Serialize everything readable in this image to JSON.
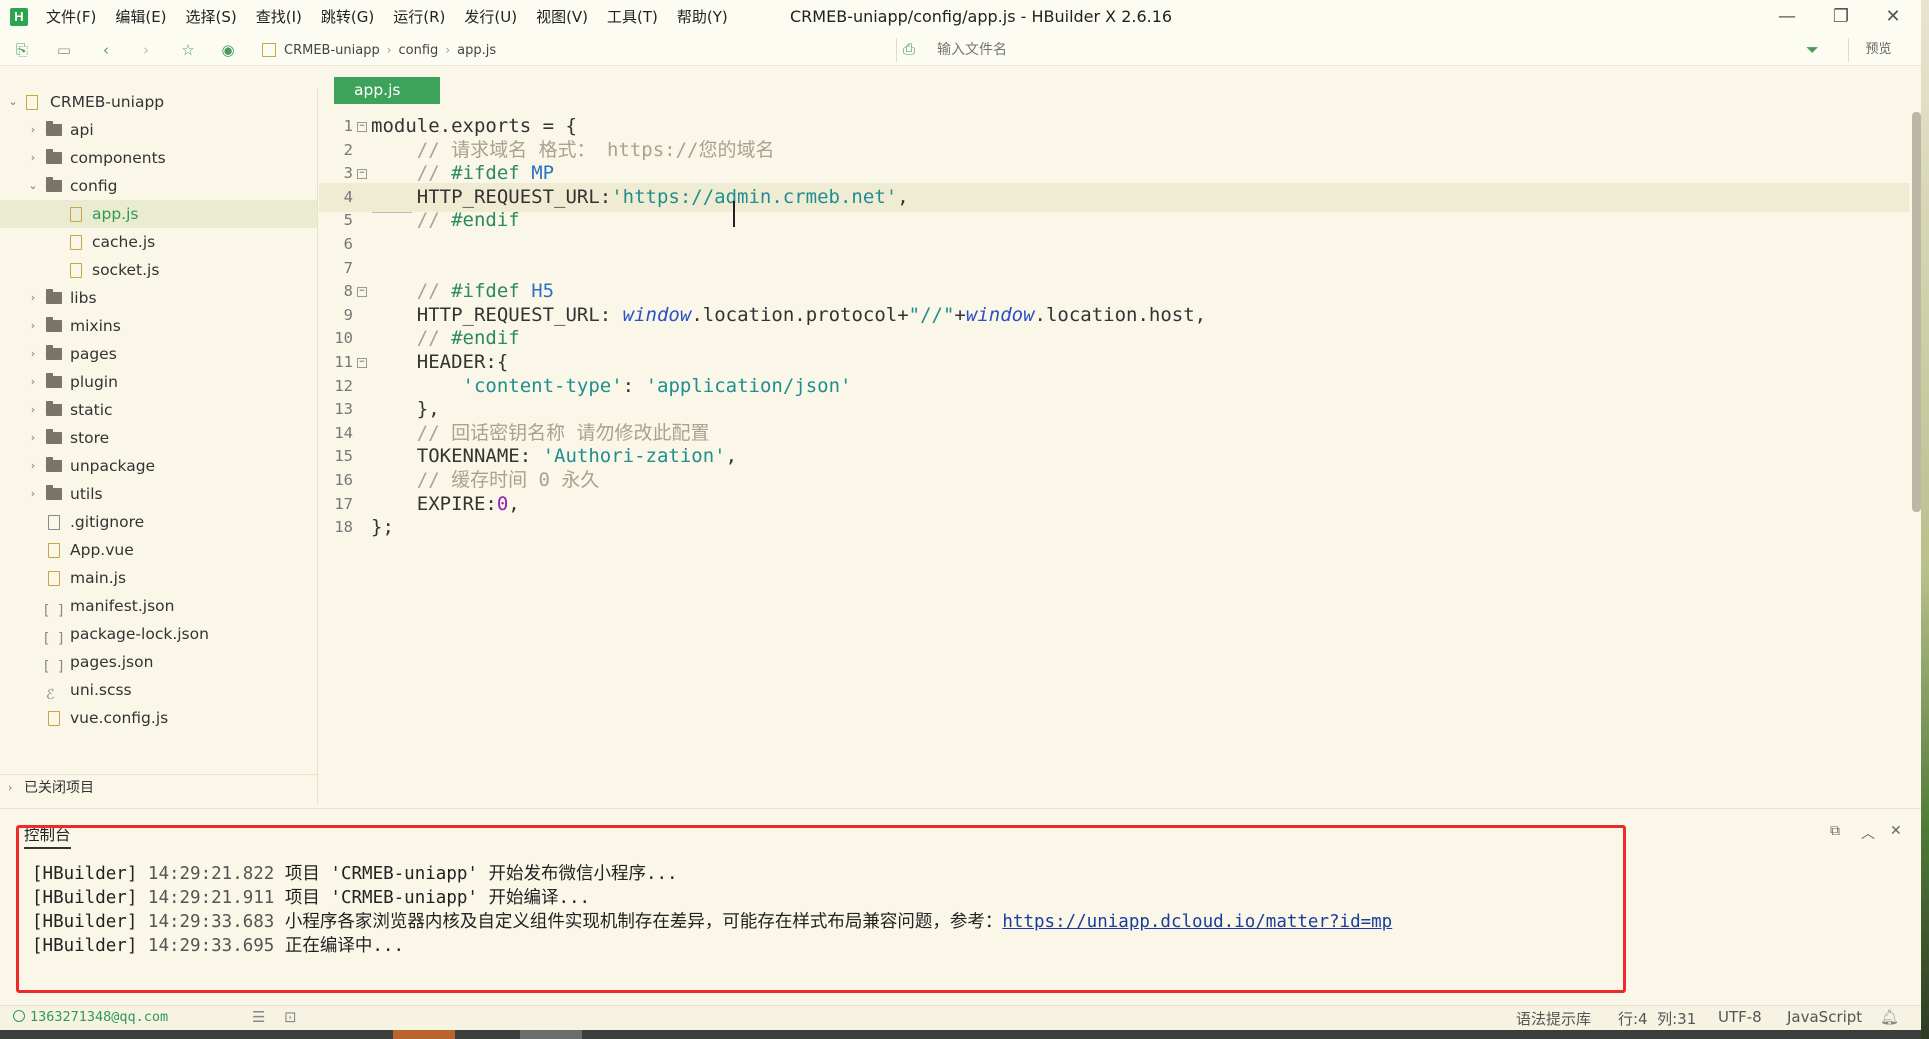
{
  "app": {
    "logo": "H",
    "title": "CRMEB-uniapp/config/app.js - HBuilder X 2.6.16"
  },
  "menu": [
    "文件(F)",
    "编辑(E)",
    "选择(S)",
    "查找(I)",
    "跳转(G)",
    "运行(R)",
    "发行(U)",
    "视图(V)",
    "工具(T)",
    "帮助(Y)"
  ],
  "window_controls": {
    "minimize": "—",
    "maximize": "❐",
    "close": "✕"
  },
  "toolbar": {
    "breadcrumb": [
      "CRMEB-uniapp",
      "config",
      "app.js"
    ],
    "file_search_placeholder": "输入文件名",
    "preview_label": "预览",
    "icons": [
      "new-file-icon",
      "save-icon",
      "back-icon",
      "forward-icon",
      "favorite-icon",
      "run-icon"
    ]
  },
  "sidebar": {
    "project": "CRMEB-uniapp",
    "items": [
      {
        "label": "api",
        "type": "folder",
        "level": 1,
        "expanded": false
      },
      {
        "label": "components",
        "type": "folder",
        "level": 1,
        "expanded": false
      },
      {
        "label": "config",
        "type": "folder",
        "level": 1,
        "expanded": true
      },
      {
        "label": "app.js",
        "type": "js",
        "level": 2,
        "selected": true
      },
      {
        "label": "cache.js",
        "type": "js",
        "level": 2
      },
      {
        "label": "socket.js",
        "type": "js",
        "level": 2
      },
      {
        "label": "libs",
        "type": "folder",
        "level": 1,
        "expanded": false
      },
      {
        "label": "mixins",
        "type": "folder",
        "level": 1,
        "expanded": false
      },
      {
        "label": "pages",
        "type": "folder",
        "level": 1,
        "expanded": false
      },
      {
        "label": "plugin",
        "type": "folder",
        "level": 1,
        "expanded": false
      },
      {
        "label": "static",
        "type": "folder",
        "level": 1,
        "expanded": false
      },
      {
        "label": "store",
        "type": "folder",
        "level": 1,
        "expanded": false
      },
      {
        "label": "unpackage",
        "type": "folder",
        "level": 1,
        "expanded": false
      },
      {
        "label": "utils",
        "type": "folder",
        "level": 1,
        "expanded": false
      },
      {
        "label": ".gitignore",
        "type": "file",
        "level": 1
      },
      {
        "label": "App.vue",
        "type": "vue",
        "level": 1
      },
      {
        "label": "main.js",
        "type": "js",
        "level": 1
      },
      {
        "label": "manifest.json",
        "type": "json",
        "level": 1
      },
      {
        "label": "package-lock.json",
        "type": "json",
        "level": 1
      },
      {
        "label": "pages.json",
        "type": "json",
        "level": 1
      },
      {
        "label": "uni.scss",
        "type": "scss",
        "level": 1
      },
      {
        "label": "vue.config.js",
        "type": "js",
        "level": 1
      }
    ],
    "closed_projects": "已关闭项目"
  },
  "editor": {
    "tab": "app.js",
    "current_line": 4,
    "lines": [
      "module.exports = {",
      "    // 请求域名 格式： https://您的域名",
      "    // #ifdef MP",
      "    HTTP_REQUEST_URL:'https://admin.crmeb.net',",
      "    // #endif",
      "",
      "",
      "    // #ifdef H5",
      "    HTTP_REQUEST_URL: window.location.protocol+\"//\"+window.location.host,",
      "    // #endif",
      "    HEADER:{",
      "        'content-type': 'application/json'",
      "    },",
      "    // 回话密钥名称 请勿修改此配置",
      "    TOKENNAME: 'Authori-zation',",
      "    // 缓存时间 0 永久",
      "    EXPIRE:0,",
      "};"
    ]
  },
  "console": {
    "title": "控制台",
    "lines": [
      {
        "tag": "[HBuilder]",
        "time": "14:29:21.822",
        "msg": "项目 'CRMEB-uniapp' 开始发布微信小程序..."
      },
      {
        "tag": "[HBuilder]",
        "time": "14:29:21.911",
        "msg": "项目 'CRMEB-uniapp' 开始编译..."
      },
      {
        "tag": "[HBuilder]",
        "time": "14:29:33.683",
        "msg": "小程序各家浏览器内核及自定义组件实现机制存在差异，可能存在样式布局兼容问题，参考：",
        "link": "https://uniapp.dcloud.io/matter?id=mp"
      },
      {
        "tag": "[HBuilder]",
        "time": "14:29:33.695",
        "msg": "正在编译中..."
      }
    ]
  },
  "status": {
    "account": "1363271348@qq.com",
    "syntax_lib": "语法提示库",
    "position": "行:4  列:31",
    "encoding": "UTF-8",
    "language": "JavaScript"
  },
  "colors": {
    "accent": "#3da35a",
    "highlight_box": "#ee2b2b",
    "background": "#faf7e8"
  }
}
